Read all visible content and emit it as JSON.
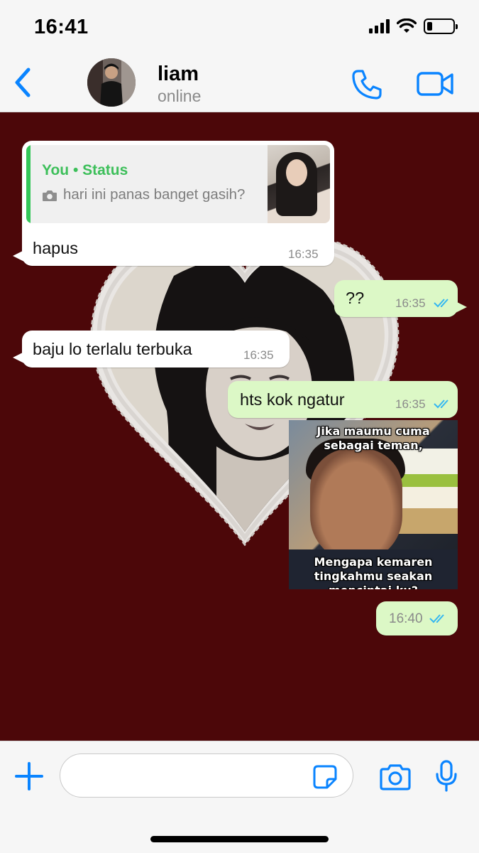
{
  "status_bar": {
    "time": "16:41",
    "battery_level": 0.2
  },
  "header": {
    "contact_name": "liam",
    "contact_status": "online"
  },
  "messages": [
    {
      "direction": "in",
      "reply": {
        "title": "You • Status",
        "text": "hari ini panas banget gasih?",
        "icon": "camera-icon"
      },
      "text": "hapus",
      "time": "16:35"
    },
    {
      "direction": "out",
      "text": "??",
      "time": "16:35",
      "status": "read"
    },
    {
      "direction": "in",
      "text": "baju lo terlalu terbuka",
      "time": "16:35"
    },
    {
      "direction": "out",
      "text": "hts kok ngatur",
      "time": "16:35",
      "status": "read"
    },
    {
      "direction": "out",
      "type": "image",
      "caption_top": "Jika maumu cuma sebagai teman,",
      "caption_bottom": "Mengapa kemaren tingkahmu seakan mencintai ku?"
    },
    {
      "direction": "out",
      "text": "",
      "time": "16:40",
      "status": "read"
    }
  ],
  "composer": {
    "placeholder": ""
  },
  "colors": {
    "accent": "#0a84ff",
    "outgoing_bubble": "#dcf8c6",
    "incoming_bubble": "#ffffff",
    "wallpaper": "#4c0709",
    "read_ticks": "#34b7f1",
    "status_title": "#3dbf5a"
  }
}
